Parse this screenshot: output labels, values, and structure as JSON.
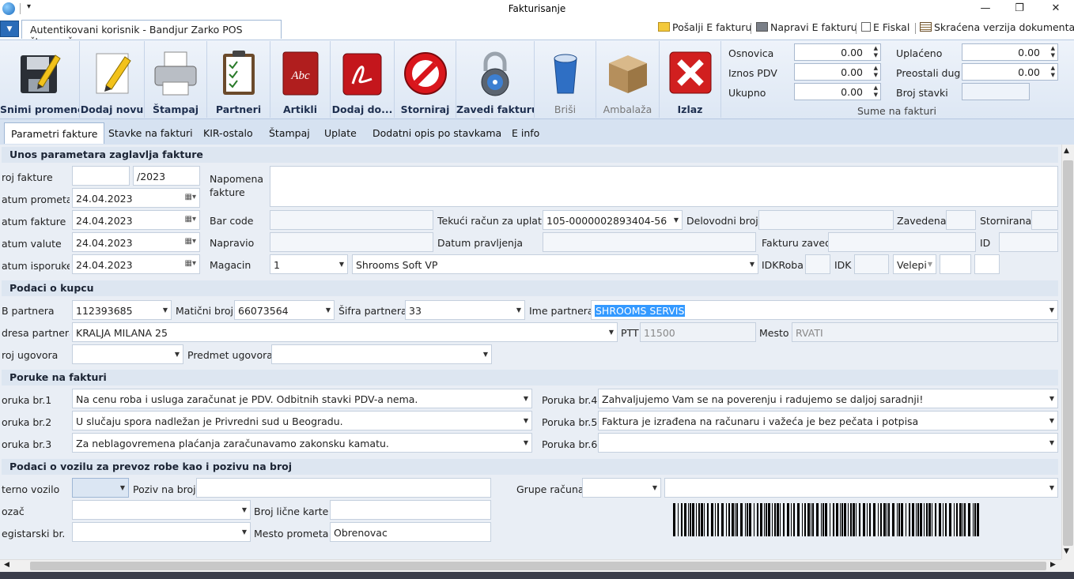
{
  "window": {
    "title": "Fakturisanje",
    "minimize": "—",
    "maximize": "❐",
    "close": "✕"
  },
  "header": {
    "user_tab": "Autentikovani korisnik - Bandjur Zarko POS štampač:",
    "links": [
      "Pošalji E fakturu",
      "Napravi E fakturu",
      "E Fiskal",
      "Skraćena verzija dokumenta"
    ]
  },
  "ribbon": {
    "buttons": [
      "Snimi promene",
      "Dodaj novu",
      "Štampaj",
      "Partneri",
      "Artikli",
      "Dodaj do...",
      "Storniraj",
      "Zavedi fakturu",
      "Briši",
      "Ambalaža",
      "Izlaz"
    ],
    "sums_title": "Sume na fakturi",
    "sums": {
      "osnovica_label": "Osnovica",
      "osnovica": "0.00",
      "pdv_label": "Iznos PDV",
      "pdv": "0.00",
      "ukupno_label": "Ukupno",
      "ukupno": "0.00",
      "uplaceno_label": "Uplaćeno",
      "uplaceno": "0.00",
      "dug_label": "Preostali dug",
      "dug": "0.00",
      "stavki_label": "Broj stavki",
      "stavki": ""
    }
  },
  "tabs": [
    "Parametri fakture",
    "Stavke na fakturi",
    "KIR-ostalo",
    "Štampaj",
    "Uplate",
    "Dodatni opis po stavkama",
    "E info"
  ],
  "s1": {
    "title": "Unos parametara zaglavlja fakture",
    "broj_label": "roj fakture",
    "broj_year": "/2023",
    "dp_label": "atum prometa",
    "dp": "24.04.2023",
    "df_label": "atum fakture",
    "df": "24.04.2023",
    "dv_label": "atum valute",
    "dv": "24.04.2023",
    "di_label": "atum isporuke",
    "di": "24.04.2023",
    "napomena_label1": "Napomena",
    "napomena_label2": "fakture",
    "barcode_label": "Bar code",
    "napravio_label": "Napravio",
    "magacin_label": "Magacin",
    "magacin": "1",
    "magacin_name": "Shrooms Soft VP",
    "tekuci_label": "Tekući račun za uplatu",
    "tekuci": "105-0000002893404-56",
    "datum_pr_label": "Datum pravljenja",
    "delovodni_label": "Delovodni broj",
    "zavedena_label": "Zavedena",
    "stornirana_label": "Stornirana",
    "zaveo_label": "Fakturu zaveo",
    "id_label": "ID",
    "idkroba_label": "IDKRoba",
    "idk_label": "IDK",
    "velep": "Velepi"
  },
  "s2": {
    "title": "Podaci o kupcu",
    "pib_label": "B partnera",
    "pib": "112393685",
    "mb_label": "Matični broj",
    "mb": "66073564",
    "sifra_label": "Šifra partnera",
    "sifra": "33",
    "ime_label": "Ime partnera",
    "ime": "SHROOMS SERVIS",
    "adresa_label": "dresa partnera",
    "adresa": "KRALJA MILANA 25",
    "ptt_label": "PTT",
    "ptt": "11500",
    "mesto_label": "Mesto",
    "mesto": "RVATI",
    "ugovor_label": "roj ugovora",
    "predmet_label": "Predmet ugovora"
  },
  "s3": {
    "title": "Poruke na fakturi",
    "p1_label": "oruka br.1",
    "p1": "Na cenu roba i usluga zaračunat je PDV. Odbitnih stavki PDV-a nema.",
    "p2_label": "oruka br.2",
    "p2": "U slučaju spora nadležan je Privredni sud u Beogradu.",
    "p3_label": "oruka br.3",
    "p3": "Za neblagovremena plaćanja zaračunavamo zakonsku kamatu.",
    "p4_label": "Poruka br.4",
    "p4": "Zahvaljujemo Vam se na poverenju i radujemo se daljoj saradnji!",
    "p5_label": "Poruka br.5",
    "p5": "Faktura je izrađena na računaru i važeća je bez pečata i potpisa",
    "p6_label": "Poruka br.6",
    "p6": ""
  },
  "s4": {
    "title": "Podaci o vozilu za prevoz robe kao i pozivu na broj",
    "interno_label": "terno vozilo",
    "poziv_label": "Poziv na broj",
    "grupe_label": "Grupe računa",
    "vozac_label": "ozač",
    "licna_label": "Broj lične karte",
    "reg_label": "egistarski br.",
    "mesto_pr_label": "Mesto prometa",
    "mesto_pr": "Obrenovac"
  },
  "colors": {
    "ribbon_bg": "#e4ecf7",
    "tab_bar": "#d6e2f1",
    "form_bg": "#e9eef5",
    "selection": "#3399ff"
  }
}
